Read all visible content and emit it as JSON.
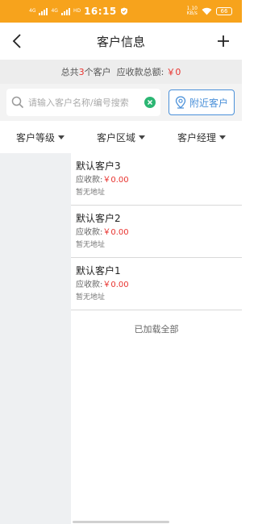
{
  "status_bar": {
    "network_a": "4G",
    "network_b": "4G",
    "hd": "HD",
    "time": "16:15",
    "speed_value": "1.10",
    "speed_unit": "KB/s",
    "battery": "66"
  },
  "header": {
    "title": "客户信息"
  },
  "summary": {
    "prefix": "总共",
    "count": "3",
    "suffix": "个客户  应收款总额:",
    "total": "￥0"
  },
  "search": {
    "placeholder": "请输入客户名称/编号搜索",
    "value": "",
    "nearby_label": "附近客户"
  },
  "filters": [
    {
      "label": "客户等级"
    },
    {
      "label": "客户区域"
    },
    {
      "label": "客户经理"
    }
  ],
  "customers": [
    {
      "name": "默认客户3",
      "receivable_label": "应收款:",
      "receivable": "￥0.00",
      "address": "暂无地址"
    },
    {
      "name": "默认客户2",
      "receivable_label": "应收款:",
      "receivable": "￥0.00",
      "address": "暂无地址"
    },
    {
      "name": "默认客户1",
      "receivable_label": "应收款:",
      "receivable": "￥0.00",
      "address": "暂无地址"
    }
  ],
  "footer": {
    "loaded_text": "已加载全部"
  },
  "colors": {
    "status_bar": "#f7a31c",
    "accent_red": "#e8332f",
    "nearby_blue": "#4a90d9",
    "clear_green": "#2bb673"
  }
}
